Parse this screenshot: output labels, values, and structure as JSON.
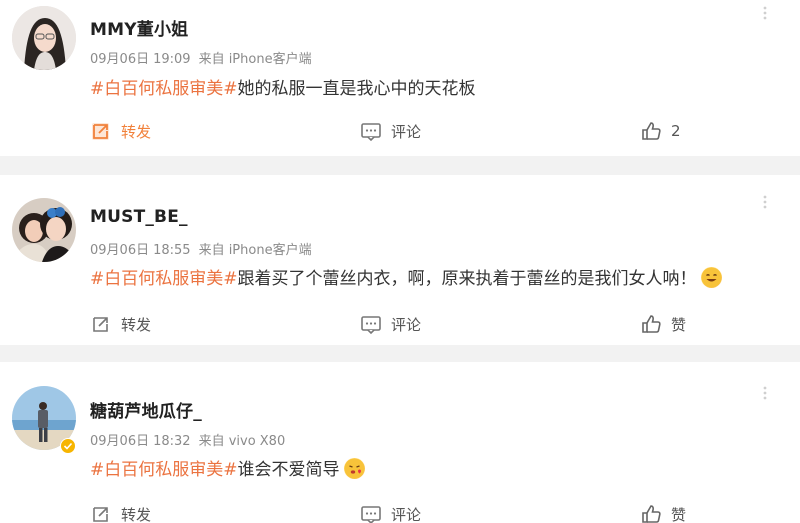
{
  "posts": [
    {
      "username": "MMY董小姐",
      "date": "09月06日",
      "time": "19:09",
      "source": "来自 iPhone客户端",
      "tag": "#白百何私服审美#",
      "text": "她的私服一直是我心中的天花板",
      "forward_label": "转发",
      "comment_label": "评论",
      "like_label": "2",
      "forward_active": true
    },
    {
      "username": "MUST_BE_",
      "date": "09月06日",
      "time": "18:55",
      "source": "来自 iPhone客户端",
      "tag": "#白百何私服审美#",
      "text": "跟着买了个蕾丝内衣，啊，原来执着于蕾丝的是我们女人呐！",
      "forward_label": "转发",
      "comment_label": "评论",
      "like_label": "赞",
      "emoji": "grin-emoji"
    },
    {
      "username": "糖葫芦地瓜仔_",
      "date": "09月06日",
      "time": "18:32",
      "source": "来自 vivo X80",
      "tag": "#白百何私服审美#",
      "text": "谁会不爱简导",
      "forward_label": "转发",
      "comment_label": "评论",
      "like_label": "赞",
      "emoji": "kiss-emoji"
    }
  ],
  "colors": {
    "tag": "#eb7340",
    "forward_active": "#f1813b",
    "meta": "#8a8a8a",
    "divider": "#f2f2f2"
  }
}
